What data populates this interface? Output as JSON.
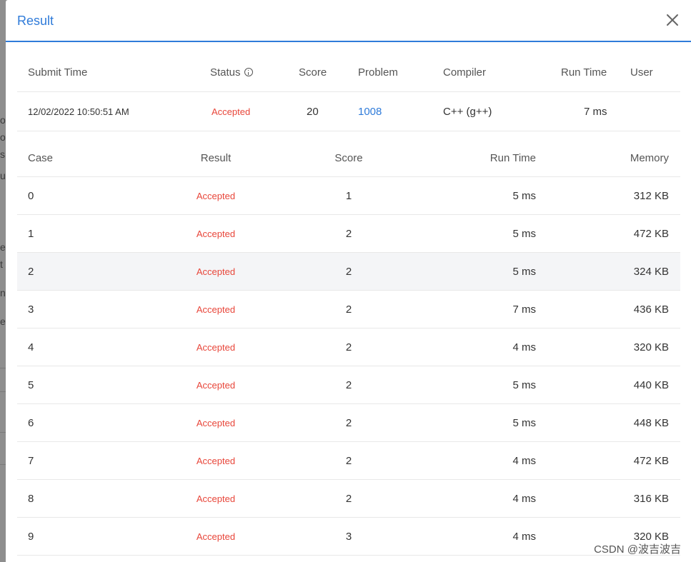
{
  "modal": {
    "title": "Result",
    "close_icon": "close-icon"
  },
  "background_fragments": [
    "o",
    "o",
    "s",
    "u",
    "e",
    "t",
    "n:",
    "e"
  ],
  "summary": {
    "headers": {
      "submit_time": "Submit Time",
      "status": "Status",
      "score": "Score",
      "problem": "Problem",
      "compiler": "Compiler",
      "run_time": "Run Time",
      "user": "User"
    },
    "status_info_icon": "info-icon",
    "row": {
      "submit_time": "12/02/2022 10:50:51 AM",
      "status": "Accepted",
      "score": "20",
      "problem": "1008",
      "compiler": "C++ (g++)",
      "run_time": "7 ms",
      "user": ""
    }
  },
  "cases": {
    "headers": {
      "case": "Case",
      "result": "Result",
      "score": "Score",
      "run_time": "Run Time",
      "memory": "Memory"
    },
    "rows": [
      {
        "case": "0",
        "result": "Accepted",
        "score": "1",
        "run_time": "5 ms",
        "memory": "312 KB"
      },
      {
        "case": "1",
        "result": "Accepted",
        "score": "2",
        "run_time": "5 ms",
        "memory": "472 KB"
      },
      {
        "case": "2",
        "result": "Accepted",
        "score": "2",
        "run_time": "5 ms",
        "memory": "324 KB"
      },
      {
        "case": "3",
        "result": "Accepted",
        "score": "2",
        "run_time": "7 ms",
        "memory": "436 KB"
      },
      {
        "case": "4",
        "result": "Accepted",
        "score": "2",
        "run_time": "4 ms",
        "memory": "320 KB"
      },
      {
        "case": "5",
        "result": "Accepted",
        "score": "2",
        "run_time": "5 ms",
        "memory": "440 KB"
      },
      {
        "case": "6",
        "result": "Accepted",
        "score": "2",
        "run_time": "5 ms",
        "memory": "448 KB"
      },
      {
        "case": "7",
        "result": "Accepted",
        "score": "2",
        "run_time": "4 ms",
        "memory": "472 KB"
      },
      {
        "case": "8",
        "result": "Accepted",
        "score": "2",
        "run_time": "4 ms",
        "memory": "316 KB"
      },
      {
        "case": "9",
        "result": "Accepted",
        "score": "3",
        "run_time": "4 ms",
        "memory": "320 KB"
      }
    ]
  },
  "watermark": "CSDN @波吉波吉",
  "colors": {
    "accent": "#2f7bd9",
    "accepted": "#e8463a",
    "row_highlight": "#f4f5f7"
  }
}
